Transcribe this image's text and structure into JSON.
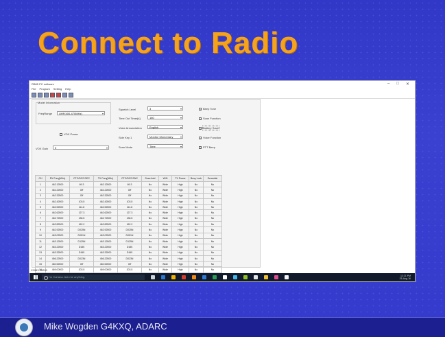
{
  "slide": {
    "title": "Connect to Radio",
    "footer": "Mike Wogden G4KXQ, ADARC"
  },
  "app": {
    "title": "RB85 PC software",
    "menu": [
      "File",
      "Program",
      "Setting",
      "Help"
    ],
    "window_controls": [
      "–",
      "□",
      "✕"
    ],
    "status": "COM3 19200"
  },
  "settings": {
    "model_group": "Model Information",
    "freq_range_label": "FreqRange",
    "freq_range_value": "UHF(400-470MHz)",
    "vox_label": "VOX Power",
    "vox_checked": false,
    "vox_gain_label": "VOX Gain",
    "vox_gain_value": "5",
    "squelch_label": "Squelch Level",
    "squelch_value": "3",
    "tot_label": "Time Out Timer[s]",
    "tot_value": "180",
    "voice_label": "Voice Annunciation",
    "voice_value": "English",
    "sidekey_label": "Side Key 1",
    "sidekey_value": "Monitor Momentary",
    "scanmode_label": "Scan Mode",
    "scanmode_value": "Time",
    "checks": [
      {
        "label": "Beep Tone",
        "checked": true
      },
      {
        "label": "Scan Function",
        "checked": true
      },
      {
        "label": "Battery Save",
        "checked": true
      },
      {
        "label": "Voice Function",
        "checked": true
      },
      {
        "label": "PTT Beep",
        "checked": true
      }
    ]
  },
  "table": {
    "headers": [
      "CH",
      "RX Freq(MHz)",
      "CTC/DCS DEC",
      "TX Freq(MHz)",
      "CTC/DCS ENC",
      "Scan Add",
      "W/N",
      "TX Power",
      "Busy Lock",
      "Scramble"
    ],
    "rows": [
      [
        "1",
        "462.12500",
        "69.3",
        "462.12500",
        "69.3",
        "No",
        "Wide",
        "High",
        "No",
        "No"
      ],
      [
        "2",
        "462.22500",
        "Off",
        "462.22500",
        "Off",
        "No",
        "Wide",
        "High",
        "No",
        "No"
      ],
      [
        "3",
        "462.32500",
        "Off",
        "462.32500",
        "Off",
        "No",
        "Wide",
        "High",
        "No",
        "No"
      ],
      [
        "4",
        "462.42500",
        "103.5",
        "462.42500",
        "103.5",
        "No",
        "Wide",
        "High",
        "No",
        "No"
      ],
      [
        "5",
        "462.52500",
        "114.8",
        "462.52500",
        "114.8",
        "No",
        "Wide",
        "High",
        "No",
        "No"
      ],
      [
        "6",
        "462.62500",
        "127.3",
        "462.62500",
        "127.3",
        "No",
        "Wide",
        "High",
        "No",
        "No"
      ],
      [
        "7",
        "462.72500",
        "136.5",
        "462.72500",
        "136.5",
        "No",
        "Wide",
        "High",
        "No",
        "No"
      ],
      [
        "8",
        "462.82500",
        "162.2",
        "462.82500",
        "162.2",
        "No",
        "Wide",
        "High",
        "No",
        "No"
      ],
      [
        "9",
        "462.92500",
        "D025N",
        "462.92500",
        "D025N",
        "No",
        "Wide",
        "High",
        "No",
        "No"
      ],
      [
        "10",
        "463.02500",
        "D051N",
        "463.02500",
        "D051N",
        "No",
        "Wide",
        "High",
        "No",
        "No"
      ],
      [
        "11",
        "463.12500",
        "D125N",
        "463.12500",
        "D125N",
        "No",
        "Wide",
        "High",
        "No",
        "No"
      ],
      [
        "12",
        "463.22500",
        "D155",
        "463.22500",
        "D155",
        "No",
        "Wide",
        "High",
        "No",
        "No"
      ],
      [
        "13",
        "463.32500",
        "D165",
        "463.32500",
        "D165",
        "No",
        "Wide",
        "High",
        "No",
        "No"
      ],
      [
        "14",
        "456.22500",
        "D023N",
        "456.22500",
        "D023N",
        "No",
        "Wide",
        "High",
        "No",
        "No"
      ],
      [
        "15",
        "460.52500",
        "Off",
        "460.52500",
        "Off",
        "No",
        "Wide",
        "High",
        "No",
        "No"
      ],
      [
        "16",
        "469.00000",
        "203.5",
        "469.00000",
        "203.5",
        "No",
        "Wide",
        "High",
        "No",
        "No"
      ]
    ]
  },
  "taskbar": {
    "search_placeholder": "I'm Cortana. Ask me anything.",
    "time": "12:21 PM",
    "date": "25-Aug-16",
    "icon_colors": [
      "#cfd3da",
      "#2b78d0",
      "#f0b400",
      "#d33c2b",
      "#f08a10",
      "#2e7bd6",
      "#2a9d55",
      "#ffffff",
      "#3fb7e8",
      "#8fc31f",
      "#e6e6e6",
      "#f2c12e",
      "#e34c8f",
      "#f6f6f6"
    ]
  }
}
